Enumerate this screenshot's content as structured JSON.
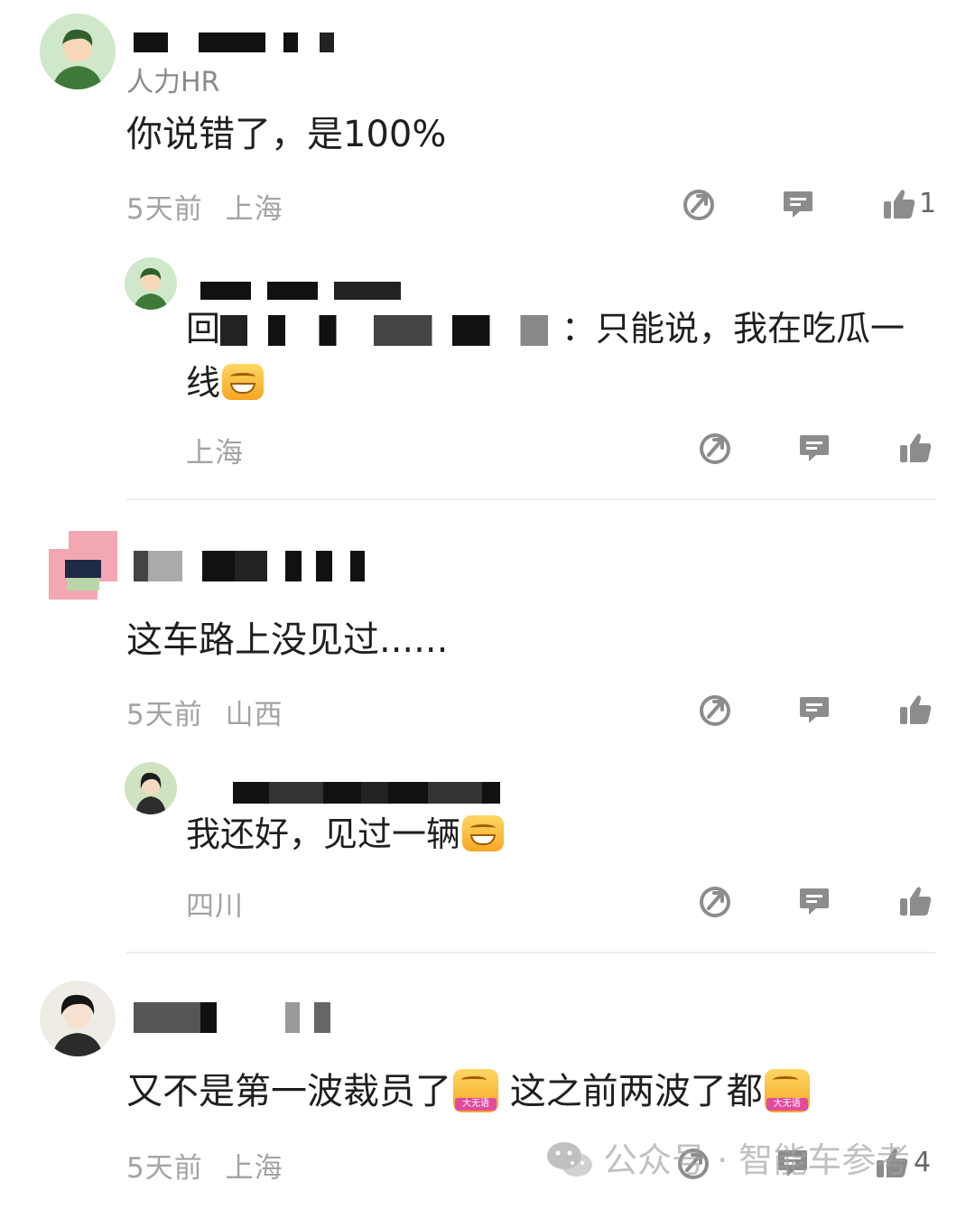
{
  "comments": [
    {
      "tag": "人力HR",
      "text": "你说错了，是100%",
      "time": "5天前",
      "location": "上海",
      "likes": "1",
      "reply": {
        "prefix": "回",
        "colon": "：",
        "text_line1": "只能说，我在吃瓜一",
        "text_line2": "线",
        "location": "上海"
      }
    },
    {
      "text": "这车路上没见过......",
      "time": "5天前",
      "location": "山西",
      "reply": {
        "text": "我还好，见过一辆",
        "location": "四川"
      }
    },
    {
      "text_part1": "又不是第一波裁员了",
      "text_part2": "这之前两波了都",
      "emoji_label": "大无语",
      "time": "5天前",
      "location": "上海",
      "likes": "4"
    }
  ],
  "watermark": {
    "text": "公众号 · 智能车参考"
  },
  "icons": {
    "share": "share-icon",
    "reply": "comment-icon",
    "like": "thumbs-up-icon"
  },
  "colors": {
    "meta_text": "#a3a3a3",
    "icon_gray": "#8c8c8c",
    "divider": "#eeeeee"
  }
}
